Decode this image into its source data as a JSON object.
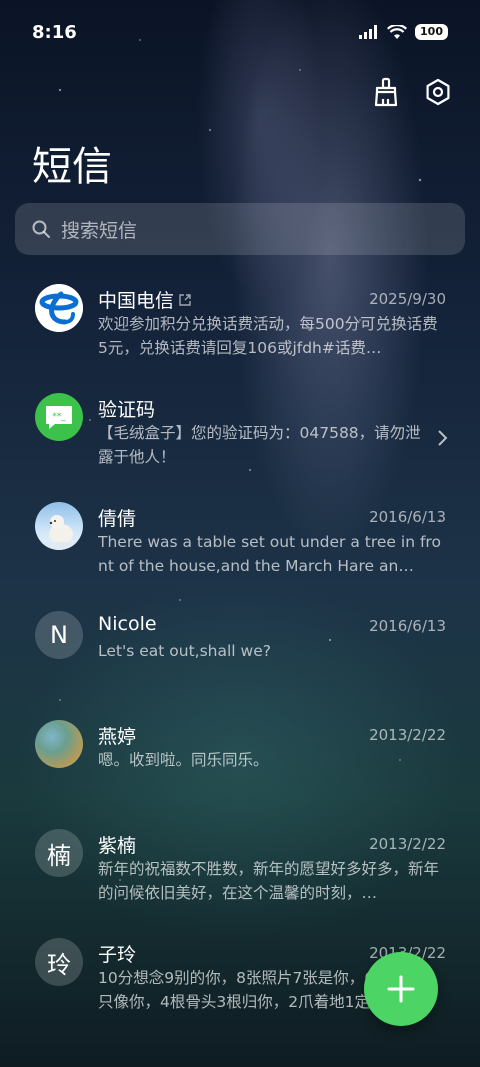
{
  "status_bar": {
    "time": "8:16",
    "battery": "100",
    "icons": [
      "signal-icon",
      "wifi-icon",
      "battery-icon"
    ]
  },
  "header": {
    "title": "短信",
    "actions": [
      "broom-clean-icon",
      "settings-hexagon-icon"
    ]
  },
  "search": {
    "placeholder": "搜索短信"
  },
  "conversations": [
    {
      "name": "中国电信",
      "date": "2025/9/30",
      "preview": "欢迎参加积分兑换话费活动，每500分可兑换话费5元，兑换话费请回复106或jfdh#话费…",
      "avatar": "china-telecom-logo"
    },
    {
      "name": "验证码",
      "date": "",
      "preview": "【毛绒盒子】您的验证码为：047588，请勿泄露于他人！",
      "avatar": "verification-code-icon"
    },
    {
      "name": "倩倩",
      "date": "2016/6/13",
      "preview": "There was a table set out under a tree in front of the house,and the March Hare an…",
      "avatar": "polar-bear-photo"
    },
    {
      "name": "Nicole",
      "date": "2016/6/13",
      "preview": "Let's eat out,shall we?",
      "avatar_letter": "N"
    },
    {
      "name": "燕婷",
      "date": "2013/2/22",
      "preview": "嗯。收到啦。同乐同乐。",
      "avatar": "landscape-photo"
    },
    {
      "name": "紫楠",
      "date": "2013/2/22",
      "preview": "新年的祝福数不胜数，新年的愿望好多好多，新年的问候依旧美好，在这个温馨的时刻，…",
      "avatar_letter": "楠"
    },
    {
      "name": "子玲",
      "date": "2013/2/22",
      "preview": "10分想念9别的你，8张照片7张是你，6只小狗5只像你，4根骨头3根归你，2爪着地1定…",
      "avatar_letter": "玲"
    }
  ],
  "colors": {
    "fab": "#4cd564",
    "telecom_blue": "#0a6fd1",
    "verification_green": "#3cc24a"
  }
}
